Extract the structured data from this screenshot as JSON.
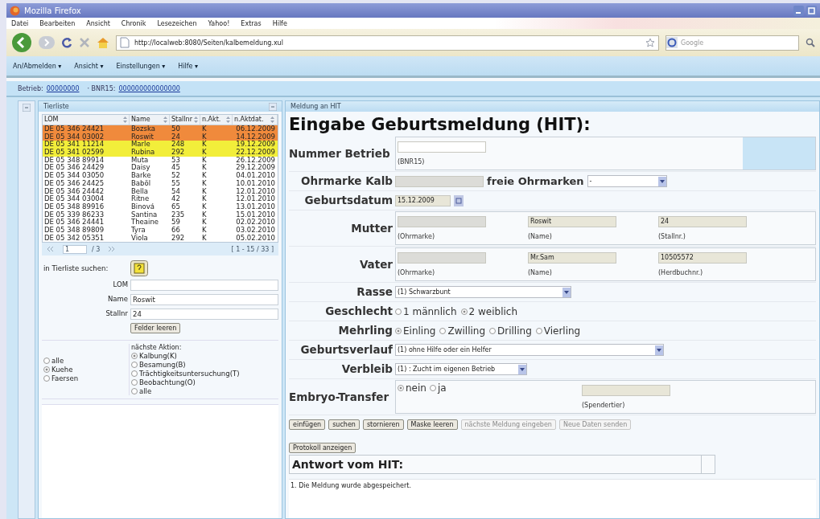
{
  "window": {
    "title": "Mozilla Firefox"
  },
  "menu_bar": [
    "Datei",
    "Bearbeiten",
    "Ansicht",
    "Chronik",
    "Lesezeichen",
    "Yahoo!",
    "Extras",
    "Hilfe"
  ],
  "address_bar": {
    "value": "http://localweb:8080/Seiten/kalbemeldung.xul"
  },
  "search_field": {
    "placeholder": "Google"
  },
  "app_menu": [
    "An/Abmelden ▾",
    "Ansicht ▾",
    "Einstellungen ▾",
    "Hilfe ▾"
  ],
  "context_bar": [
    {
      "label": "Betrieb:",
      "value": "00000000"
    },
    {
      "label": "· BNR15:",
      "value": "000000000000000"
    }
  ],
  "animal_list": {
    "title": "Tierliste",
    "columns": [
      "LOM",
      "Name",
      "Stallnr",
      "n.Akt.",
      "n.Aktdat."
    ],
    "rows": [
      {
        "cells": [
          "DE 05 346 24421",
          "Bozska",
          "50",
          "K",
          "06.12.2009"
        ],
        "color": "#f08a3c"
      },
      {
        "cells": [
          "DE 05 344 03002",
          "Roswit",
          "24",
          "K",
          "14.12.2009"
        ],
        "color": "#f08a3c"
      },
      {
        "cells": [
          "DE 05 341 11214",
          "Marle",
          "248",
          "K",
          "19.12.2009"
        ],
        "color": "#f2ee3a"
      },
      {
        "cells": [
          "DE 05 341 02599",
          "Rubina",
          "292",
          "K",
          "22.12.2009"
        ],
        "color": "#f2ee3a"
      },
      {
        "cells": [
          "DE 05 348 89914",
          "Muta",
          "53",
          "K",
          "26.12.2009"
        ],
        "color": "#ffffff"
      },
      {
        "cells": [
          "DE 05 346 24429",
          "Daisy",
          "45",
          "K",
          "29.12.2009"
        ],
        "color": "#ffffff"
      },
      {
        "cells": [
          "DE 05 344 03050",
          "Barke",
          "52",
          "K",
          "04.01.2010"
        ],
        "color": "#ffffff"
      },
      {
        "cells": [
          "DE 05 346 24425",
          "Baböl",
          "55",
          "K",
          "10.01.2010"
        ],
        "color": "#ffffff"
      },
      {
        "cells": [
          "DE 05 346 24442",
          "Bella",
          "54",
          "K",
          "12.01.2010"
        ],
        "color": "#ffffff"
      },
      {
        "cells": [
          "DE 05 344 03004",
          "Ritne",
          "42",
          "K",
          "12.01.2010"
        ],
        "color": "#ffffff"
      },
      {
        "cells": [
          "DE 05 348 89916",
          "Binová",
          "65",
          "K",
          "13.01.2010"
        ],
        "color": "#ffffff"
      },
      {
        "cells": [
          "DE 05 339 86233",
          "Santina",
          "235",
          "K",
          "15.01.2010"
        ],
        "color": "#ffffff"
      },
      {
        "cells": [
          "DE 05 346 24441",
          "Theaine",
          "59",
          "K",
          "02.02.2010"
        ],
        "color": "#ffffff"
      },
      {
        "cells": [
          "DE 05 348 89809",
          "Tyra",
          "66",
          "K",
          "03.02.2010"
        ],
        "color": "#ffffff"
      },
      {
        "cells": [
          "DE 05 342 05351",
          "Viola",
          "292",
          "K",
          "05.02.2010"
        ],
        "color": "#ffffff"
      }
    ],
    "pager": {
      "page": "1",
      "pages": "/ 3",
      "range": "[ 1 - 15 / 33 ]"
    }
  },
  "list_search": {
    "label": "in Tierliste suchen:",
    "fields": [
      {
        "label": "LOM"
      },
      {
        "label": "Name",
        "value": "Roswit"
      },
      {
        "label": "Stallnr",
        "value": "24"
      }
    ],
    "clear_button": "Felder leeren",
    "animal_filter": [
      {
        "label": "alle",
        "selected": false
      },
      {
        "label": "Kuehe",
        "selected": true
      },
      {
        "label": "Faersen",
        "selected": false
      }
    ],
    "next_action_label": "nächste Aktion:",
    "next_action": [
      {
        "label": "Kalbung(K)",
        "selected": true
      },
      {
        "label": "Besamung(B)",
        "selected": false
      },
      {
        "label": "Trächtigkeitsuntersuchung(T)",
        "selected": false
      },
      {
        "label": "Beobachtung(O)",
        "selected": false
      },
      {
        "label": "alle",
        "selected": false
      }
    ]
  },
  "report_panel": {
    "title": "Meldung an HIT",
    "heading": "Eingabe Geburtsmeldung (HIT):",
    "rows": [
      {
        "kind": "group",
        "label": "Nummer Betrieb",
        "fields": [
          {
            "caption": "(BNR15)"
          }
        ]
      },
      {
        "kind": "eartag",
        "label": "Ohrmarke Kalb",
        "extra_label": "freie Ohrmarken",
        "select": "-"
      },
      {
        "kind": "date",
        "label": "Geburtsdatum",
        "value": "15.12.2009"
      },
      {
        "kind": "group",
        "label": "Mutter",
        "fields": [
          {
            "caption": "(Ohrmarke)"
          },
          {
            "value": "Roswit",
            "caption": "(Name)"
          },
          {
            "value": "24",
            "caption": "(Stallnr.)"
          }
        ]
      },
      {
        "kind": "group",
        "label": "Vater",
        "fields": [
          {
            "caption": "(Ohrmarke)"
          },
          {
            "value": "Mr.Sam",
            "caption": "(Name)"
          },
          {
            "value": "10505572",
            "caption": "(Herdbuchnr.)"
          }
        ]
      },
      {
        "kind": "select",
        "label": "Rasse",
        "value": "(1) Schwarzbunt"
      },
      {
        "kind": "radio",
        "label": "Geschlecht",
        "options": [
          {
            "label": "1 männlich",
            "selected": false
          },
          {
            "label": "2 weiblich",
            "selected": true
          }
        ]
      },
      {
        "kind": "radio",
        "label": "Mehrling",
        "options": [
          {
            "label": "Einling",
            "selected": true
          },
          {
            "label": "Zwilling",
            "selected": false
          },
          {
            "label": "Drilling",
            "selected": false
          },
          {
            "label": "Vierling",
            "selected": false
          }
        ]
      },
      {
        "kind": "select",
        "label": "Geburtsverlauf",
        "value": "(1) ohne Hilfe oder ein Helfer"
      },
      {
        "kind": "select",
        "label": "Verbleib",
        "value": "(1) : Zucht im eigenen Betrieb"
      },
      {
        "kind": "embryo",
        "label": "Embryo-Transfer",
        "options": [
          {
            "label": "nein",
            "selected": true
          },
          {
            "label": "ja",
            "selected": false
          }
        ],
        "caption": "(Spendertier)"
      }
    ],
    "buttons": [
      {
        "label": "einfügen",
        "disabled": false
      },
      {
        "label": "suchen",
        "disabled": false
      },
      {
        "label": "stornieren",
        "disabled": false
      },
      {
        "label": "Maske leeren",
        "disabled": false
      },
      {
        "label": "nächste Meldung eingeben",
        "disabled": true
      },
      {
        "label": "Neue Daten senden",
        "disabled": true
      }
    ],
    "protocol_button": "Protokoll anzeigen",
    "response_heading": "Antwort vom HIT:",
    "response_message": "1. Die Meldung wurde abgespeichert."
  }
}
